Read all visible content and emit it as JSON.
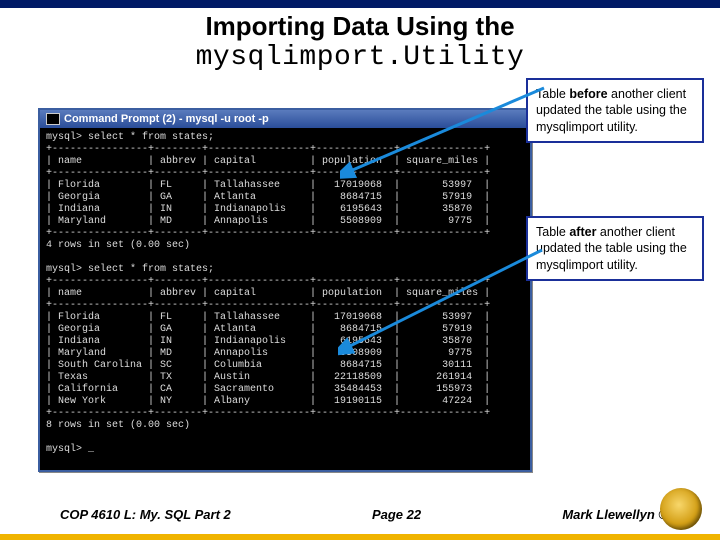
{
  "title": {
    "line1": "Importing Data Using the",
    "line2": "mysqlimport.Utility"
  },
  "terminal": {
    "window_title": "Command Prompt (2) - mysql -u root -p",
    "prompt_query": "mysql> select * from states;",
    "divider_top": "+----------------+--------+-----------------+-------------+--------------+",
    "header_row": "| name           | abbrev | capital         | population  | square_miles |",
    "divider_mid": "+----------------+--------+-----------------+-------------+--------------+",
    "before_rows": [
      "| Florida        | FL     | Tallahassee     |   17019068  |       53997  |",
      "| Georgia        | GA     | Atlanta         |    8684715  |       57919  |",
      "| Indiana        | IN     | Indianapolis    |    6195643  |       35870  |",
      "| Maryland       | MD     | Annapolis       |    5508909  |        9775  |"
    ],
    "divider_bot": "+----------------+--------+-----------------+-------------+--------------+",
    "before_status": "4 rows in set (0.00 sec)",
    "after_rows": [
      "| Florida        | FL     | Tallahassee     |   17019068  |       53997  |",
      "| Georgia        | GA     | Atlanta         |    8684715  |       57919  |",
      "| Indiana        | IN     | Indianapolis    |    6195643  |       35870  |",
      "| Maryland       | MD     | Annapolis       |    5508909  |        9775  |",
      "| South Carolina | SC     | Columbia        |    8684715  |       30111  |",
      "| Texas          | TX     | Austin          |   22118509  |      261914  |",
      "| California     | CA     | Sacramento      |   35484453  |      155973  |",
      "| New York       | NY     | Albany          |   19190115  |       47224  |"
    ],
    "after_status": "8 rows in set (0.00 sec)",
    "final_prompt": "mysql> _"
  },
  "callouts": {
    "before_html": "Table <b>before</b> another client updated the table using the mysqlimport utility.",
    "after_html": "Table <b>after</b> another client updated the table using the mysqlimport utility."
  },
  "footer": {
    "left": "COP 4610 L: My. SQL Part 2",
    "mid": "Page 22",
    "right": "Mark Llewellyn ©"
  },
  "colors": {
    "header_bar": "#001a66",
    "callout_border": "#1a2f99",
    "arrow": "#1a8adb",
    "gold": "#f0b400"
  }
}
